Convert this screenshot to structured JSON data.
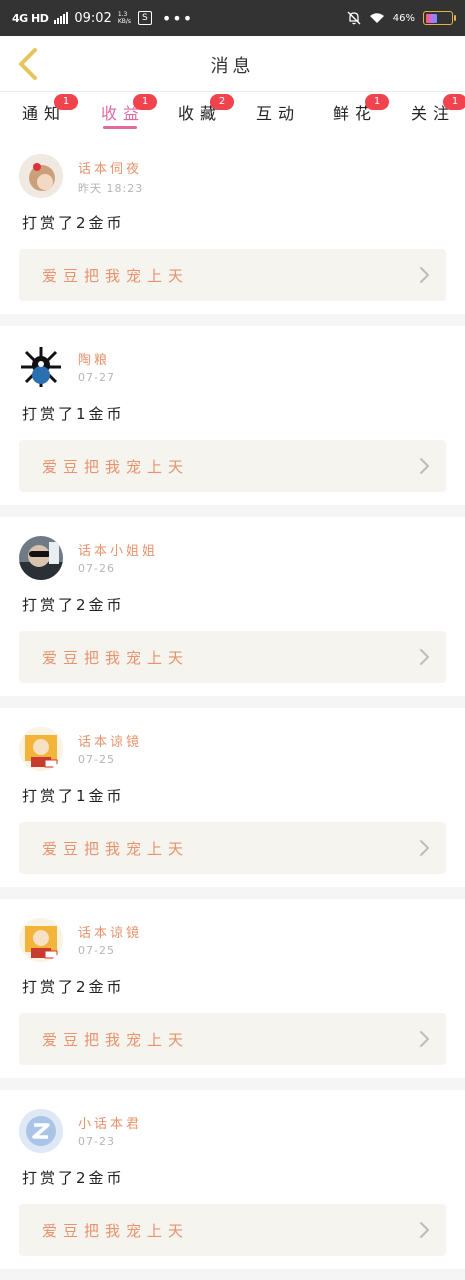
{
  "status_bar": {
    "network": "4G HD",
    "time": "09:02",
    "speed": "1.3 KB/s",
    "app_icon": "S",
    "more": "•••",
    "battery_pct": "46%",
    "battery_level": 0.46
  },
  "header": {
    "title": "消息",
    "back_icon": "chevron-left-icon",
    "accent": "#e6c65b"
  },
  "tabs": [
    {
      "label": "通知",
      "badge": "1",
      "active": false
    },
    {
      "label": "收益",
      "badge": "1",
      "active": true
    },
    {
      "label": "收藏",
      "badge": "2",
      "active": false
    },
    {
      "label": "互动",
      "badge": "",
      "active": false
    },
    {
      "label": "鲜花",
      "badge": "1",
      "active": false
    },
    {
      "label": "关注",
      "badge": "1",
      "active": false
    }
  ],
  "colors": {
    "active_tab": "#e06aa4",
    "badge": "#f0434d",
    "username": "#e8936d",
    "book_title": "#e8936d",
    "book_bg": "#f5f4ee"
  },
  "items": [
    {
      "username": "话本伺夜",
      "time": "昨天 18:23",
      "message": "打赏了2金币",
      "book_title": "爱豆把我宠上天",
      "avatar": "avatar-girl-red-flower"
    },
    {
      "username": "陶粮",
      "time": "07-27",
      "message": "打赏了1金币",
      "book_title": "爱豆把我宠上天",
      "avatar": "avatar-globe-black"
    },
    {
      "username": "话本小姐姐",
      "time": "07-26",
      "message": "打赏了2金币",
      "book_title": "爱豆把我宠上天",
      "avatar": "avatar-sunglasses"
    },
    {
      "username": "话本谅镜",
      "time": "07-25",
      "message": "打赏了1金币",
      "book_title": "爱豆把我宠上天",
      "avatar": "avatar-cartoon-yellow"
    },
    {
      "username": "话本谅镜",
      "time": "07-25",
      "message": "打赏了2金币",
      "book_title": "爱豆把我宠上天",
      "avatar": "avatar-cartoon-yellow"
    },
    {
      "username": "小话本君",
      "time": "07-23",
      "message": "打赏了2金币",
      "book_title": "爱豆把我宠上天",
      "avatar": "avatar-default-blue"
    }
  ]
}
